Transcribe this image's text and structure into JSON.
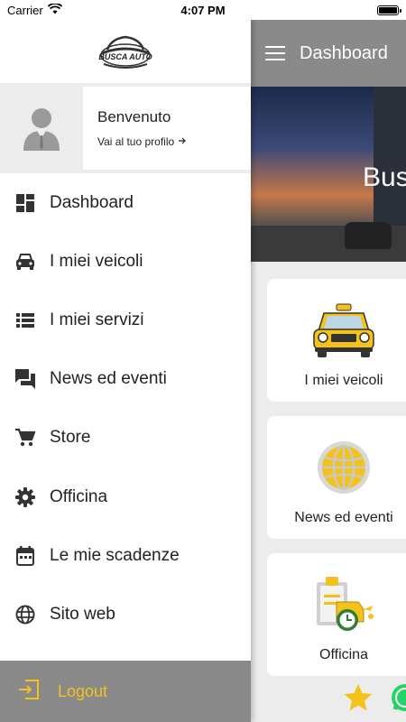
{
  "status_bar": {
    "carrier": "Carrier",
    "time": "4:07 PM"
  },
  "app_bar": {
    "title": "Dashboard"
  },
  "hero": {
    "text": "Bus"
  },
  "drawer": {
    "logo_text": "BUSCA AUTO",
    "profile": {
      "welcome": "Benvenuto",
      "link": "Vai al tuo profilo"
    },
    "items": [
      {
        "label": "Dashboard",
        "icon": "dashboard-icon"
      },
      {
        "label": "I miei veicoli",
        "icon": "car-icon"
      },
      {
        "label": "I miei servizi",
        "icon": "list-icon"
      },
      {
        "label": "News ed eventi",
        "icon": "chat-icon"
      },
      {
        "label": "Store",
        "icon": "cart-icon"
      },
      {
        "label": "Officina",
        "icon": "gear-icon"
      },
      {
        "label": "Le mie scadenze",
        "icon": "calendar-icon"
      },
      {
        "label": "Sito web",
        "icon": "globe-icon"
      }
    ],
    "logout_label": "Logout"
  },
  "cards": [
    {
      "label": "I miei veicoli",
      "icon": "taxi-icon"
    },
    {
      "label": "News ed eventi",
      "icon": "globe-icon"
    },
    {
      "label": "Officina",
      "icon": "clipboard-oil-icon"
    }
  ],
  "colors": {
    "accent_yellow": "#f4c21b",
    "drawer_footer_gray": "#8a8a8a",
    "icon_dark": "#333333"
  }
}
